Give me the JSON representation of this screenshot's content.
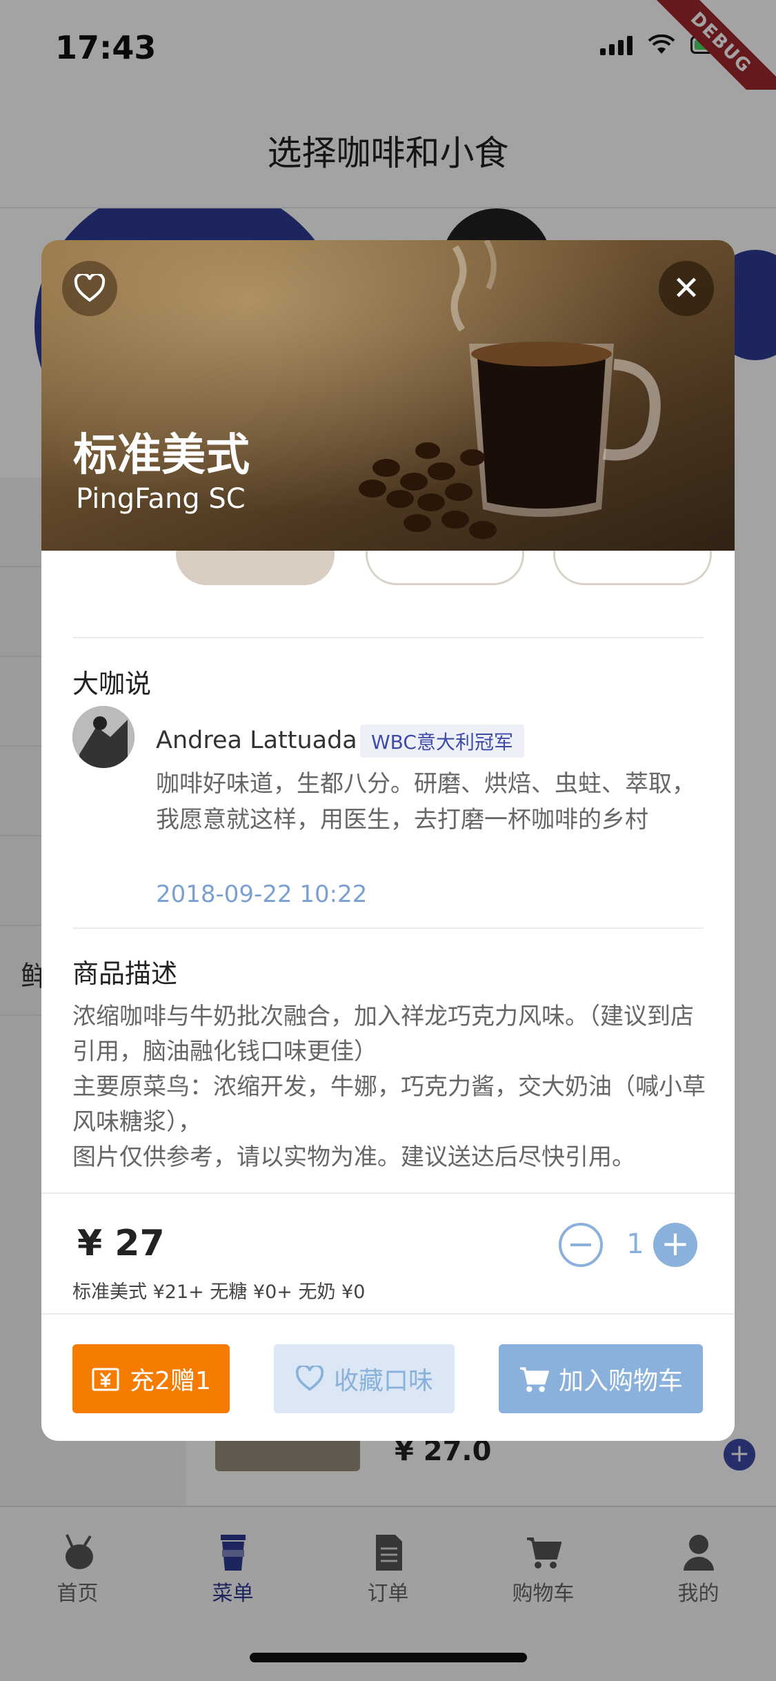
{
  "status_bar": {
    "time": "17:43"
  },
  "debug_label": "DEBUG",
  "app_header": {
    "title": "选择咖啡和小食"
  },
  "categories": [
    "",
    "",
    "",
    "",
    "",
    "鲜"
  ],
  "background_product": {
    "price": "¥ 27.0"
  },
  "tabs": [
    {
      "label": "首页",
      "icon": "home-icon"
    },
    {
      "label": "菜单",
      "icon": "cup-icon",
      "active": true
    },
    {
      "label": "订单",
      "icon": "order-icon"
    },
    {
      "label": "购物车",
      "icon": "cart-icon"
    },
    {
      "label": "我的",
      "icon": "profile-icon"
    }
  ],
  "modal": {
    "title": "标准美式",
    "subtitle": "PingFang SC",
    "review_section": {
      "heading": "大咖说",
      "reviewer": "Andrea Lattuada",
      "badge": "WBC意大利冠军",
      "text": "咖啡好味道，生都八分。研磨、烘焙、虫蛀、萃取，我愿意就这样，用医生，去打磨一杯咖啡的乡村",
      "date": "2018-09-22 10:22"
    },
    "description_section": {
      "heading": "商品描述",
      "lines": [
        "浓缩咖啡与牛奶批次融合，加入祥龙巧克力风味。（建议到店引用，脑油融化钱口味更佳）",
        "主要原菜鸟：浓缩开发，牛娜，巧克力酱，交大奶油（喊小草风味糖浆），",
        "图片仅供参考，请以实物为准。建议送达后尽快引用。"
      ]
    },
    "price": "¥ 27",
    "price_detail": "标准美式 ¥21+ 无糖 ¥0+ 无奶 ¥0",
    "quantity": "1",
    "buttons": {
      "promo": "充2赠1",
      "favorite": "收藏口味",
      "add_to_cart": "加入购物车"
    }
  },
  "colors": {
    "brand_blue": "#2c3a94",
    "accent_blue": "#8ab0dc",
    "promo_orange": "#f57c00"
  }
}
